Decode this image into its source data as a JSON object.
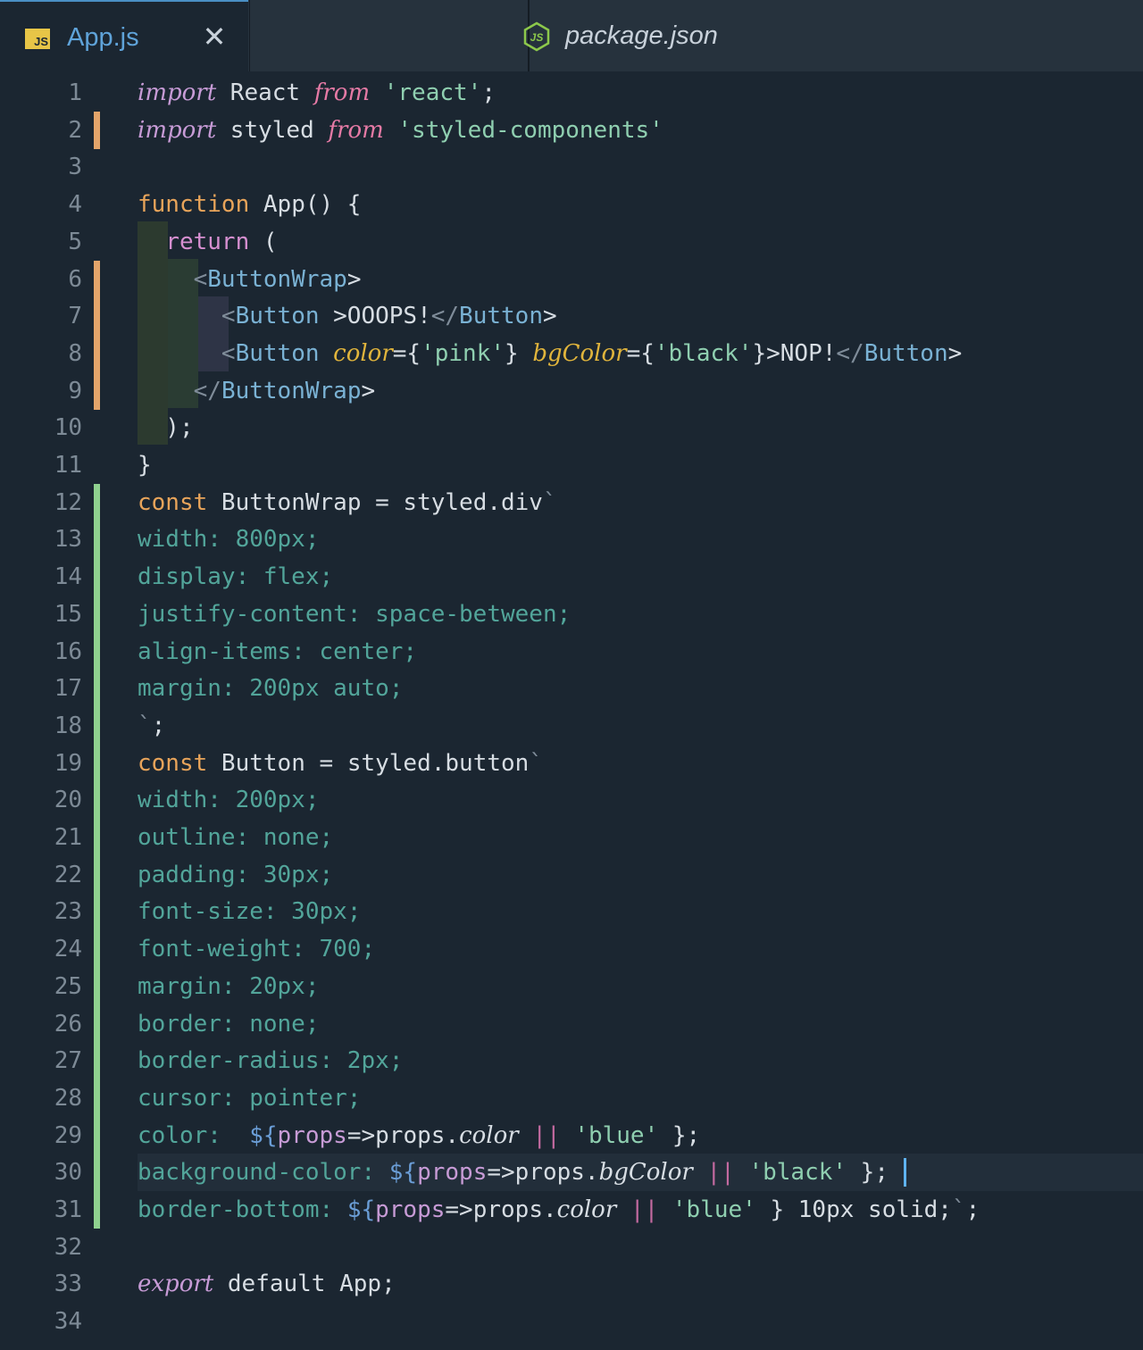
{
  "tabs": [
    {
      "label": "App.js",
      "icon": "js-file-icon",
      "icon_text": "JS",
      "active": true,
      "close_glyph": "✕"
    },
    {
      "label": "package.json",
      "icon": "nodejs-icon",
      "active": false
    }
  ],
  "editor": {
    "lines": [
      {
        "num": "1",
        "git": "none",
        "text": "import React from 'react';"
      },
      {
        "num": "2",
        "git": "modified",
        "text": "import styled from 'styled-components'"
      },
      {
        "num": "3",
        "git": "none",
        "text": ""
      },
      {
        "num": "4",
        "git": "none",
        "text": "function App() {"
      },
      {
        "num": "5",
        "git": "none",
        "text": "  return ("
      },
      {
        "num": "6",
        "git": "modified",
        "text": "    <ButtonWrap>"
      },
      {
        "num": "7",
        "git": "modified",
        "text": "      <Button >OOOPS!</Button>"
      },
      {
        "num": "8",
        "git": "modified",
        "text": "      <Button color={'pink'} bgColor={'black'}>NOP!</Button>"
      },
      {
        "num": "9",
        "git": "modified",
        "text": "    </ButtonWrap>"
      },
      {
        "num": "10",
        "git": "none",
        "text": "  );"
      },
      {
        "num": "11",
        "git": "none",
        "text": "}"
      },
      {
        "num": "12",
        "git": "added",
        "text": "const ButtonWrap = styled.div`"
      },
      {
        "num": "13",
        "git": "added",
        "text": "width: 800px;"
      },
      {
        "num": "14",
        "git": "added",
        "text": "display: flex;"
      },
      {
        "num": "15",
        "git": "added",
        "text": "justify-content: space-between;"
      },
      {
        "num": "16",
        "git": "added",
        "text": "align-items: center;"
      },
      {
        "num": "17",
        "git": "added",
        "text": "margin: 200px auto;"
      },
      {
        "num": "18",
        "git": "added",
        "text": "`;"
      },
      {
        "num": "19",
        "git": "added",
        "text": "const Button = styled.button`"
      },
      {
        "num": "20",
        "git": "added",
        "text": "width: 200px;"
      },
      {
        "num": "21",
        "git": "added",
        "text": "outline: none;"
      },
      {
        "num": "22",
        "git": "added",
        "text": "padding: 30px;"
      },
      {
        "num": "23",
        "git": "added",
        "text": "font-size: 30px;"
      },
      {
        "num": "24",
        "git": "added",
        "text": "font-weight: 700;"
      },
      {
        "num": "25",
        "git": "added",
        "text": "margin: 20px;"
      },
      {
        "num": "26",
        "git": "added",
        "text": "border: none;"
      },
      {
        "num": "27",
        "git": "added",
        "text": "border-radius: 2px;"
      },
      {
        "num": "28",
        "git": "added",
        "text": "cursor: pointer;"
      },
      {
        "num": "29",
        "git": "added",
        "text": "color:  ${props=>props.color || 'blue' };"
      },
      {
        "num": "30",
        "git": "added",
        "text": "background-color: ${props=>props.bgColor || 'black' };",
        "current": true
      },
      {
        "num": "31",
        "git": "added",
        "text": "border-bottom: ${props=>props.color || 'blue' } 10px solid;`;"
      },
      {
        "num": "32",
        "git": "none",
        "text": ""
      },
      {
        "num": "33",
        "git": "none",
        "text": "export default App;"
      },
      {
        "num": "34",
        "git": "none",
        "text": ""
      }
    ]
  },
  "colors": {
    "background": "#1b2631",
    "tabbar": "#26323d",
    "git_modified": "#e3a46a",
    "git_added": "#8fd18f",
    "cursor": "#5fb3f0"
  }
}
